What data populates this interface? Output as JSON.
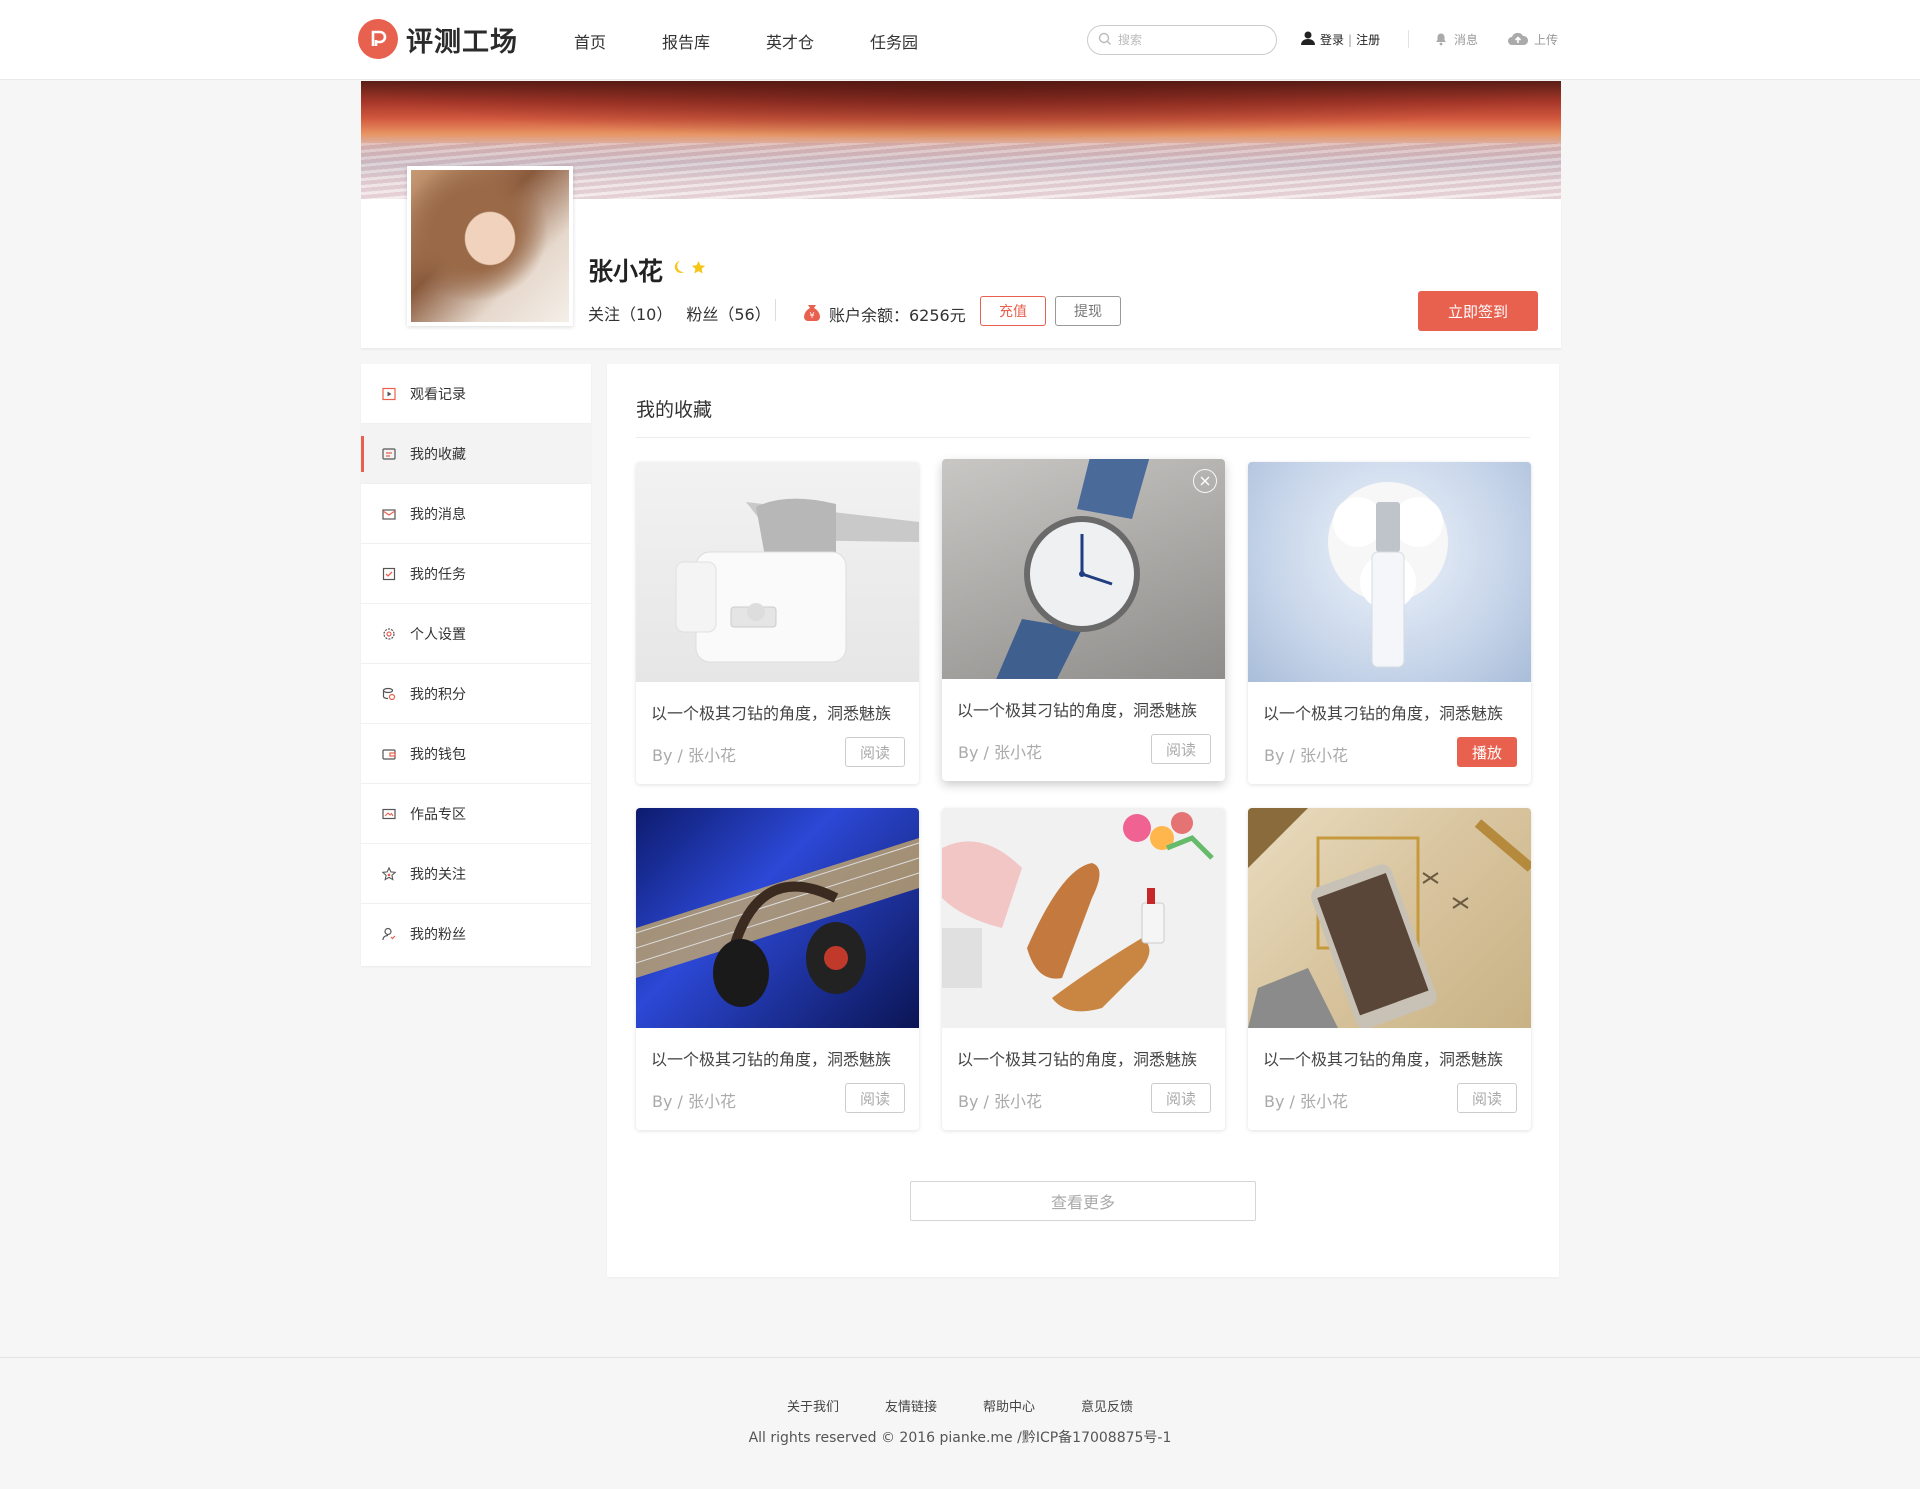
{
  "app": {
    "logo_text": "评测工场",
    "brand_color": "#e8604e"
  },
  "nav": {
    "items": [
      "首页",
      "报告库",
      "英才仓",
      "任务园"
    ]
  },
  "search": {
    "placeholder": "搜索"
  },
  "account": {
    "login": "登录",
    "separator": "|",
    "register": "注册"
  },
  "tools": {
    "messages": "消息",
    "upload": "上传"
  },
  "profile": {
    "name": "张小花",
    "following": "关注（10）",
    "fans": "粉丝（56）",
    "balance": "账户余额：6256元",
    "recharge": "充值",
    "withdraw": "提现",
    "checkin": "立即签到"
  },
  "sidebar": {
    "items": [
      {
        "label": "观看记录",
        "icon": "video-icon"
      },
      {
        "label": "我的收藏",
        "icon": "bookmark-icon",
        "active": true
      },
      {
        "label": "我的消息",
        "icon": "mail-icon"
      },
      {
        "label": "我的任务",
        "icon": "task-icon"
      },
      {
        "label": "个人设置",
        "icon": "gear-icon"
      },
      {
        "label": "我的积分",
        "icon": "coins-icon"
      },
      {
        "label": "我的钱包",
        "icon": "wallet-icon"
      },
      {
        "label": "作品专区",
        "icon": "gallery-icon"
      },
      {
        "label": "我的关注",
        "icon": "star-icon"
      },
      {
        "label": "我的粉丝",
        "icon": "user-icon"
      }
    ]
  },
  "main": {
    "title": "我的收藏",
    "cards": [
      {
        "title": "以一个极其刁钻的角度，洞悉魅族",
        "author": "By / 张小花",
        "action": "阅读",
        "image": "faucet-filter"
      },
      {
        "title": "以一个极其刁钻的角度，洞悉魅族",
        "author": "By / 张小花",
        "action": "阅读",
        "image": "wristwatch"
      },
      {
        "title": "以一个极其刁钻的角度，洞悉魅族",
        "author": "By / 张小花",
        "action": "播放",
        "image": "skincare-bottle"
      },
      {
        "title": "以一个极其刁钻的角度，洞悉魅族",
        "author": "By / 张小花",
        "action": "阅读",
        "image": "headphones-guitar"
      },
      {
        "title": "以一个极其刁钻的角度，洞悉魅族",
        "author": "By / 张小花",
        "action": "阅读",
        "image": "shoes-flatlay"
      },
      {
        "title": "以一个极其刁钻的角度，洞悉魅族",
        "author": "By / 张小花",
        "action": "阅读",
        "image": "gold-phone"
      }
    ],
    "more": "查看更多"
  },
  "footer": {
    "links": [
      "关于我们",
      "友情链接",
      "帮助中心",
      "意见反馈"
    ],
    "copyright": "All rights reserved © 2016 pianke.me /黔ICP备17008875号-1"
  }
}
